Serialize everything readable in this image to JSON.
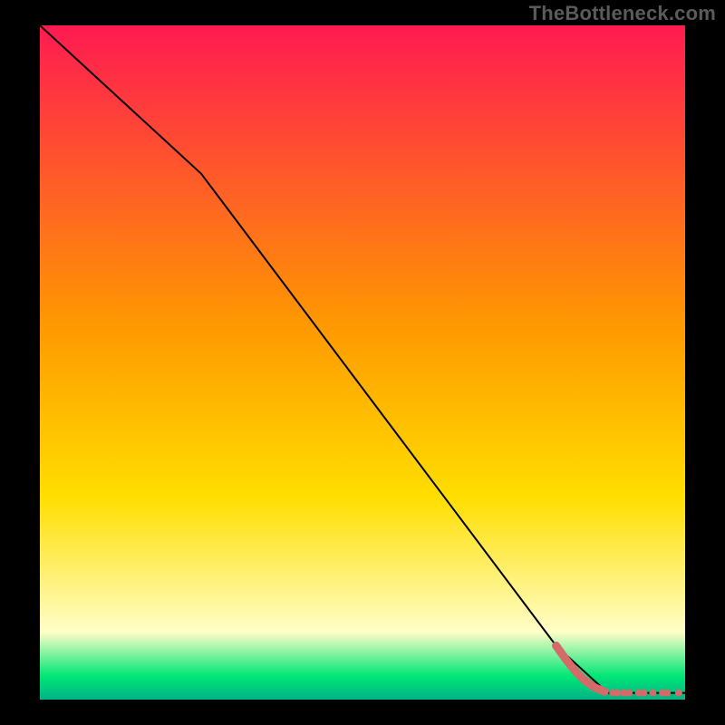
{
  "watermark": "TheBottleneck.com",
  "chart_data": {
    "type": "line",
    "title": "",
    "xlabel": "",
    "ylabel": "",
    "xlim": [
      0,
      100
    ],
    "ylim": [
      0,
      100
    ],
    "grid": false,
    "legend": false,
    "background_gradient": {
      "top_color": "#ff1a52",
      "mid_color": "#ffde00",
      "bottom_yellow": "#fffec8",
      "green": "#00e676",
      "teal": "#00b386"
    },
    "series": [
      {
        "name": "bottleneck-curve",
        "color": "#000000",
        "x": [
          0,
          25,
          80,
          88,
          100
        ],
        "y": [
          100,
          78,
          8,
          1,
          1
        ]
      }
    ],
    "markers": {
      "name": "highlight-segment",
      "color": "#d46a6a",
      "points": [
        {
          "x": 80.0,
          "y": 8.0
        },
        {
          "x": 81.5,
          "y": 6.0
        },
        {
          "x": 83.0,
          "y": 4.2
        },
        {
          "x": 84.5,
          "y": 2.8
        },
        {
          "x": 86.0,
          "y": 1.8
        },
        {
          "x": 87.5,
          "y": 1.2
        },
        {
          "x": 88.8,
          "y": 1.0
        },
        {
          "x": 89.5,
          "y": 1.0
        },
        {
          "x": 90.5,
          "y": 1.0
        },
        {
          "x": 91.3,
          "y": 1.0
        },
        {
          "x": 92.8,
          "y": 1.0
        },
        {
          "x": 93.6,
          "y": 1.0
        },
        {
          "x": 95.0,
          "y": 1.0
        },
        {
          "x": 96.5,
          "y": 1.0
        },
        {
          "x": 97.2,
          "y": 1.0
        },
        {
          "x": 99.0,
          "y": 1.0
        }
      ]
    }
  }
}
